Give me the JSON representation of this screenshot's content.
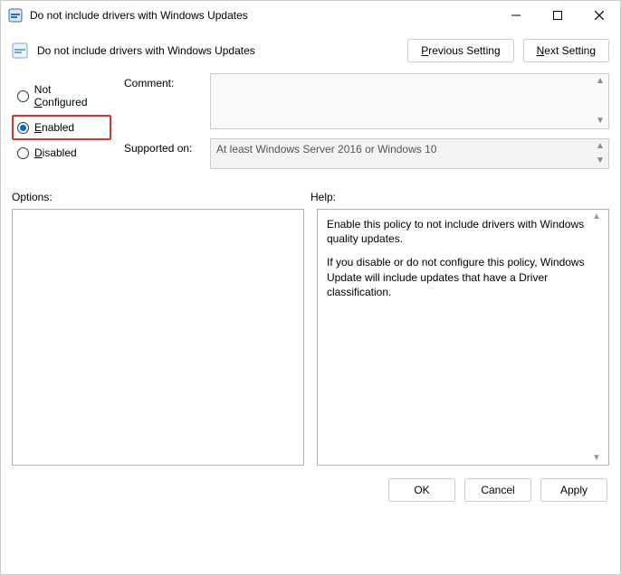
{
  "window": {
    "title": "Do not include drivers with Windows Updates"
  },
  "subheader": {
    "title": "Do not include drivers with Windows Updates",
    "prev_btn_pre": "P",
    "prev_btn_rest": "revious Setting",
    "next_btn_pre": "N",
    "next_btn_rest": "ext Setting"
  },
  "radios": {
    "not_configured_pre": "Not ",
    "not_configured_u": "C",
    "not_configured_post": "onfigured",
    "enabled_u": "E",
    "enabled_post": "nabled",
    "disabled_u": "D",
    "disabled_post": "isabled",
    "selected": "enabled"
  },
  "fields": {
    "comment_label": "Comment:",
    "comment_value": "",
    "supported_label": "Supported on:",
    "supported_value": "At least Windows Server 2016 or Windows 10"
  },
  "sections": {
    "options_label": "Options:",
    "help_label": "Help:"
  },
  "help": {
    "p1": "Enable this policy to not include drivers with Windows quality updates.",
    "p2": "If you disable or do not configure this policy, Windows Update will include updates that have a Driver classification."
  },
  "footer": {
    "ok": "OK",
    "cancel": "Cancel",
    "apply": "Apply"
  }
}
